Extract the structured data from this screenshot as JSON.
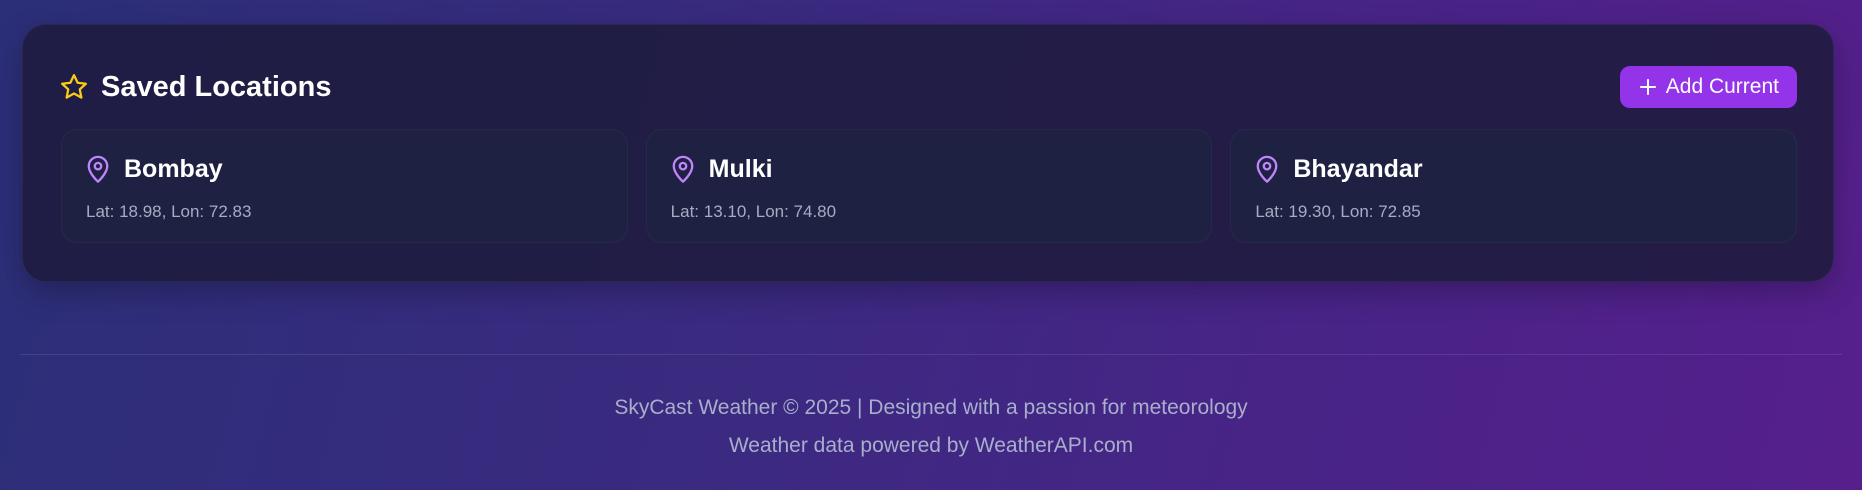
{
  "saved_locations": {
    "title": "Saved Locations",
    "title_icon": "star-icon",
    "add_button_label": "Add Current",
    "add_button_icon": "plus-icon",
    "accent_color": "#9333ea",
    "star_color": "#facc15",
    "pin_color": "#c084fc",
    "items": [
      {
        "name": "Bombay",
        "coords": "Lat: 18.98, Lon: 72.83",
        "icon": "map-pin-icon"
      },
      {
        "name": "Mulki",
        "coords": "Lat: 13.10, Lon: 74.80",
        "icon": "map-pin-icon"
      },
      {
        "name": "Bhayandar",
        "coords": "Lat: 19.30, Lon: 72.85",
        "icon": "map-pin-icon"
      }
    ]
  },
  "footer": {
    "line1": "SkyCast Weather © 2025 | Designed with a passion for meteorology",
    "line2": "Weather data powered by WeatherAPI.com"
  }
}
